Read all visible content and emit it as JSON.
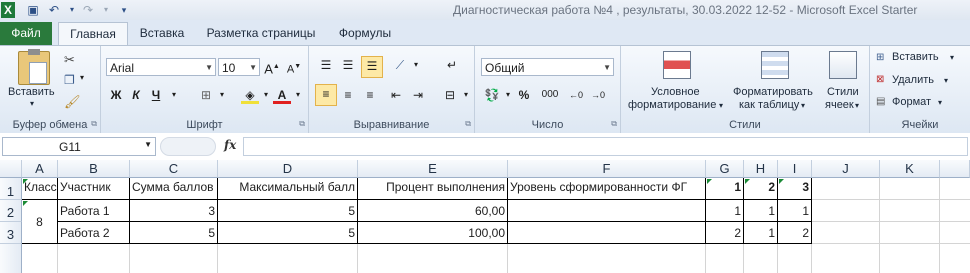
{
  "window": {
    "title": "Диагностическая работа №4 , результаты, 30.03.2022 12-52  -  Microsoft Excel Starter"
  },
  "ribbon": {
    "tabs": [
      "Файл",
      "Главная",
      "Вставка",
      "Разметка страницы",
      "Формулы"
    ],
    "active_tab": "Главная",
    "clipboard": {
      "paste": "Вставить",
      "group": "Буфер обмена"
    },
    "font": {
      "name": "Arial",
      "size": "10",
      "bold": "Ж",
      "italic": "К",
      "underline": "Ч",
      "group": "Шрифт"
    },
    "alignment": {
      "group": "Выравнивание"
    },
    "number": {
      "format": "Общий",
      "percent": "%",
      "thousands": "000",
      "group": "Число"
    },
    "styles": {
      "conditional": "Условное",
      "conditional2": "форматирование",
      "table": "Форматировать",
      "table2": "как таблицу",
      "cell": "Стили",
      "cell2": "ячеек",
      "group": "Стили"
    },
    "cells": {
      "insert": "Вставить",
      "delete": "Удалить",
      "format": "Формат",
      "group": "Ячейки"
    }
  },
  "formula_bar": {
    "name_box": "G11",
    "fx": "fx",
    "formula": ""
  },
  "grid": {
    "columns": [
      "A",
      "B",
      "C",
      "D",
      "E",
      "F",
      "G",
      "H",
      "I",
      "J",
      "K"
    ],
    "rows": [
      "1",
      "2",
      "3"
    ],
    "header_row": [
      "Класс",
      "Участник",
      "Сумма баллов",
      "Максимальный балл",
      "Процент выполнения",
      "Уровень сформированности ФГ",
      "1",
      "2",
      "3"
    ],
    "merged_A": "8",
    "data_rows": [
      [
        "Работа 1",
        "3",
        "5",
        "60,00",
        "",
        "1",
        "1",
        "1"
      ],
      [
        "Работа 2",
        "5",
        "5",
        "100,00",
        "",
        "2",
        "1",
        "2"
      ]
    ]
  }
}
